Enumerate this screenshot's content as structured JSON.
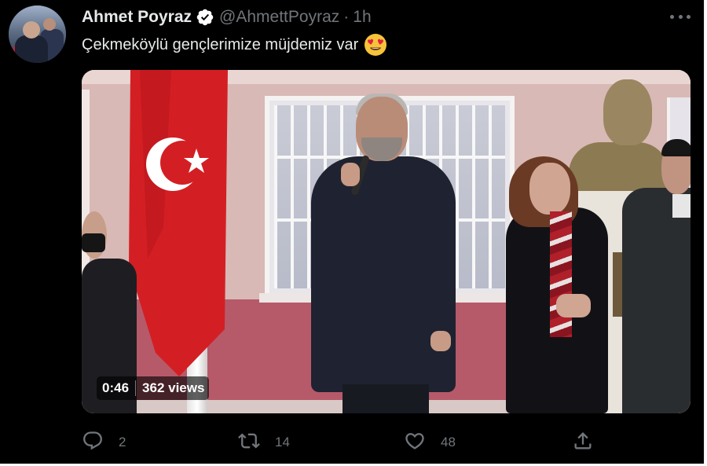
{
  "tweet": {
    "author_name": "Ahmet Poyraz",
    "handle": "@AhmettPoyraz",
    "separator": "·",
    "time": "1h",
    "text": "Çekmeköylü gençlerimize müjdemiz var",
    "emoji": "heart-eyes-emoji",
    "verified": true,
    "more_icon": "more-icon"
  },
  "media": {
    "type": "video",
    "duration": "0:46",
    "views": "362 views"
  },
  "actions": {
    "reply": {
      "icon": "reply-icon",
      "count": "2"
    },
    "retweet": {
      "icon": "retweet-icon",
      "count": "14"
    },
    "like": {
      "icon": "like-icon",
      "count": "48"
    },
    "share": {
      "icon": "share-icon"
    }
  },
  "colors": {
    "background": "#000000",
    "primary_text": "#e7e9ea",
    "secondary_text": "#71767b",
    "verified": "#ffffff"
  }
}
